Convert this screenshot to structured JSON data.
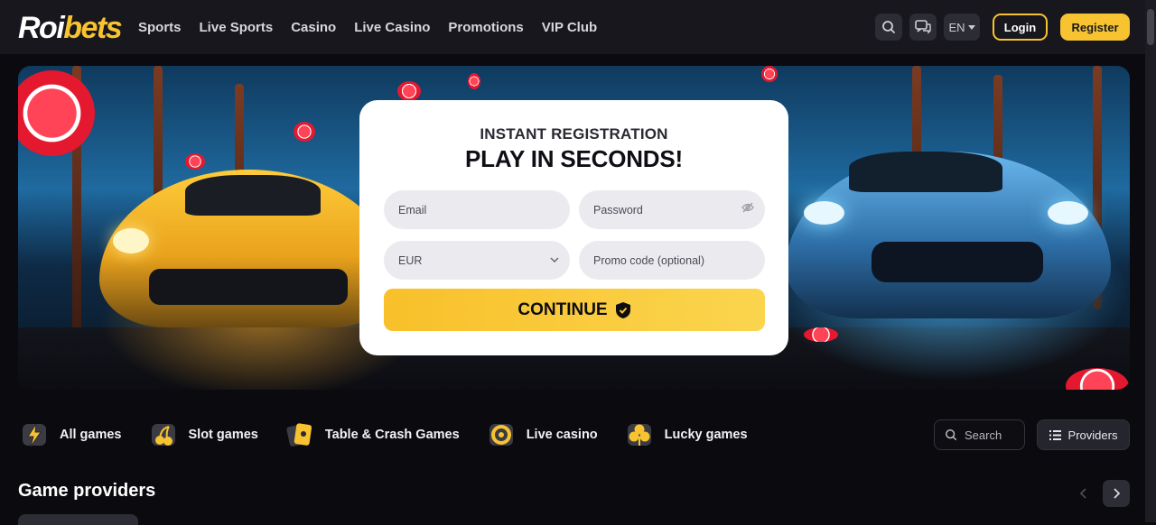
{
  "header": {
    "logo": {
      "part1": "Roi",
      "part2": "bets"
    },
    "nav": [
      "Sports",
      "Live Sports",
      "Casino",
      "Live Casino",
      "Promotions",
      "VIP Club"
    ],
    "language": "EN",
    "login_label": "Login",
    "register_label": "Register",
    "icons": [
      "search-icon",
      "chat-icon",
      "chevron-down-icon"
    ]
  },
  "registration": {
    "subtitle": "INSTANT REGISTRATION",
    "title": "PLAY IN SECONDS!",
    "email_placeholder": "Email",
    "password_placeholder": "Password",
    "currency_value": "EUR",
    "promo_placeholder": "Promo code (optional)",
    "continue_label": "CONTINUE"
  },
  "categories": [
    {
      "label": "All games",
      "icon": "lightning-icon"
    },
    {
      "label": "Slot games",
      "icon": "cherry-icon"
    },
    {
      "label": "Table & Crash Games",
      "icon": "cards-icon"
    },
    {
      "label": "Live casino",
      "icon": "roulette-icon"
    },
    {
      "label": "Lucky games",
      "icon": "clover-icon"
    }
  ],
  "search": {
    "placeholder": "Search"
  },
  "providers_button": "Providers",
  "section": {
    "title": "Game providers"
  },
  "colors": {
    "accent": "#f7c331",
    "background": "#0b0b0f",
    "header": "#17171d"
  }
}
